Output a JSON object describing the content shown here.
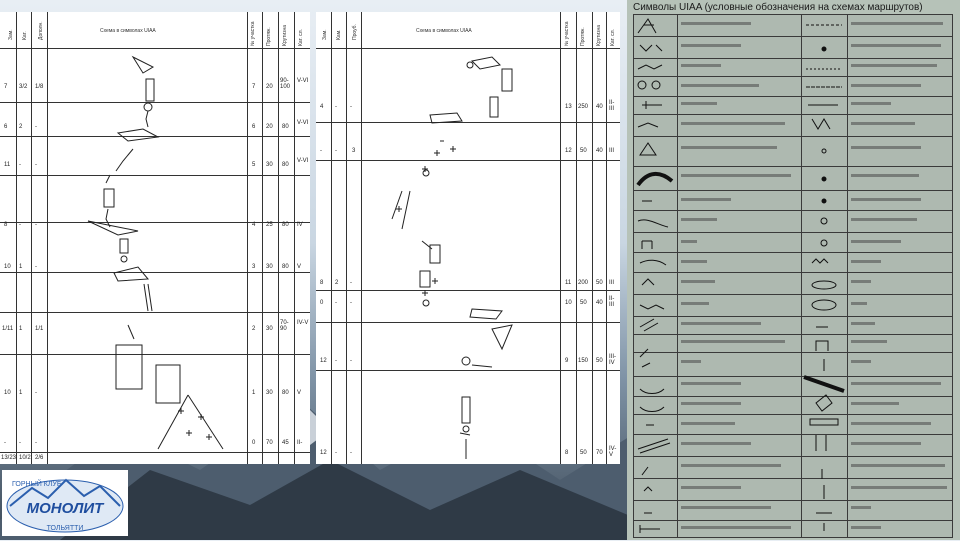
{
  "left_sheet": {
    "headers": [
      "Зам.",
      "Кат.",
      "Дополн.",
      "Схема в символах UIAA",
      "№ участка",
      "Протяж.",
      "Крутизна",
      "Кат. сл."
    ],
    "rows": [
      {
        "a": "7",
        "b": "3/2",
        "c": "1/8",
        "n": "7",
        "len": "20",
        "deg": "90-100",
        "cat": "V-VI"
      },
      {
        "a": "6",
        "b": "2",
        "c": "-",
        "n": "6",
        "len": "20",
        "deg": "80",
        "cat": "V-VI"
      },
      {
        "a": "11",
        "b": "-",
        "c": "-",
        "n": "5",
        "len": "30",
        "deg": "80",
        "cat": "V-VI"
      },
      {
        "a": "8",
        "b": "-",
        "c": "-",
        "n": "4",
        "len": "25",
        "deg": "80",
        "cat": "IV"
      },
      {
        "a": "10",
        "b": "1",
        "c": "-",
        "n": "3",
        "len": "30",
        "deg": "80",
        "cat": "V"
      },
      {
        "a": "1/11",
        "b": "1",
        "c": "1/1",
        "n": "2",
        "len": "30",
        "deg": "70-90",
        "cat": "IV-V"
      },
      {
        "a": "10",
        "b": "1",
        "c": "-",
        "n": "1",
        "len": "30",
        "deg": "80",
        "cat": "V"
      },
      {
        "a": "-",
        "b": "-",
        "c": "-",
        "n": "0",
        "len": "70",
        "deg": "45",
        "cat": "II-"
      }
    ],
    "totals": {
      "a": "13/23",
      "b": "10/2",
      "c": "2/6"
    }
  },
  "right_sheet": {
    "headers": [
      "Зам.",
      "Кам.",
      "Проуб.",
      "Схема в символах UIAA",
      "№ участка",
      "Протяж.",
      "Крутизна",
      "Кат. сл."
    ],
    "rows": [
      {
        "a": "4",
        "b": "-",
        "c": "-",
        "n": "13",
        "len": "250",
        "deg": "40",
        "cat": "II-III"
      },
      {
        "a": "-",
        "b": "-",
        "c": "3",
        "n": "12",
        "len": "50",
        "deg": "40",
        "cat": "III"
      },
      {
        "a": "8",
        "b": "2",
        "c": "-",
        "n": "11",
        "len": "200",
        "deg": "50",
        "cat": "III"
      },
      {
        "a": "0",
        "b": "-",
        "c": "-",
        "n": "10",
        "len": "50",
        "deg": "40",
        "cat": "II-III"
      },
      {
        "a": "12",
        "b": "-",
        "c": "-",
        "n": "9",
        "len": "150",
        "deg": "50",
        "cat": "III-IV"
      },
      {
        "a": "12",
        "b": "-",
        "c": "-",
        "n": "8",
        "len": "50",
        "deg": "70",
        "cat": "IV-V"
      }
    ]
  },
  "legend": {
    "title": "Символы UIAA (условные обозначения на схемах маршрутов)"
  },
  "logo": {
    "top": "ГОРНЫЙ КЛУБ",
    "name": "МОНОЛИТ",
    "bottom": "ТОЛЬЯТТИ"
  }
}
